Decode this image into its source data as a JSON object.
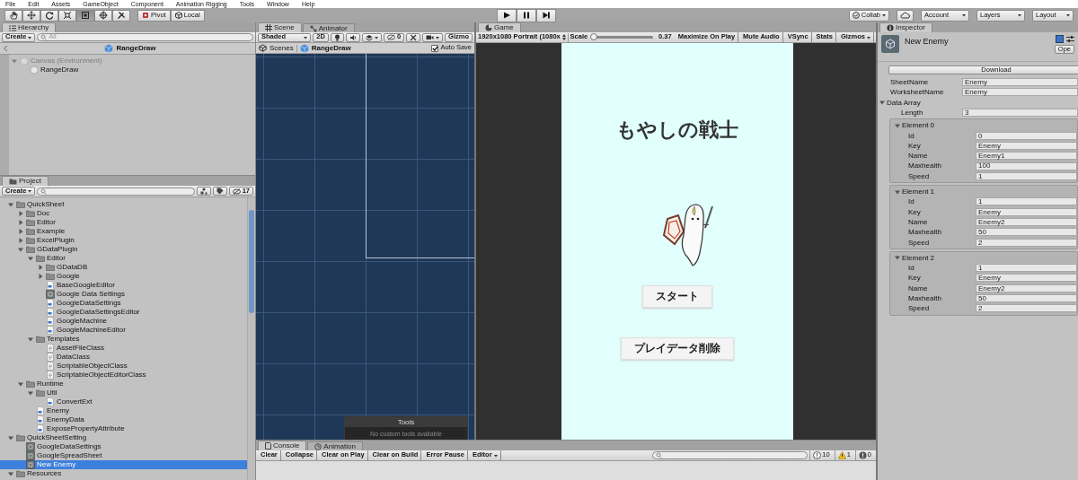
{
  "menu": [
    "File",
    "Edit",
    "Assets",
    "GameObject",
    "Component",
    "Animation Rigging",
    "Tools",
    "Window",
    "Help"
  ],
  "toolbar": {
    "tools": [
      {
        "kind": "hand",
        "selected": false
      },
      {
        "kind": "move",
        "selected": false
      },
      {
        "kind": "rotate",
        "selected": false
      },
      {
        "kind": "scale",
        "selected": false
      },
      {
        "kind": "rect",
        "selected": true
      },
      {
        "kind": "transform",
        "selected": false
      },
      {
        "kind": "custom",
        "selected": false
      }
    ],
    "pivot": "Pivot",
    "local": "Local",
    "playback": [
      {
        "kind": "play"
      },
      {
        "kind": "pause"
      },
      {
        "kind": "step"
      }
    ],
    "collab": "Collab",
    "account": "Account",
    "layers": "Layers",
    "layout": "Layout"
  },
  "hierarchy": {
    "tab": "Hierarchy",
    "create": "Create",
    "search_placeholder": "All",
    "scene": "RangeDraw",
    "items": [
      {
        "label": "Canvas (Environment)",
        "kind": "gameobject",
        "dimmed": true,
        "selected": false,
        "expanded": true,
        "children": [
          {
            "label": "RangeDraw",
            "kind": "gameobject",
            "dimmed": false,
            "selected": false
          }
        ]
      }
    ]
  },
  "project": {
    "tab": "Project",
    "create": "Create",
    "hidden_count": "17",
    "tree": [
      {
        "label": "QuickSheet",
        "kind": "folder",
        "expanded": true,
        "selected": false,
        "children": [
          {
            "label": "Doc",
            "kind": "folder",
            "expanded": false,
            "selected": false
          },
          {
            "label": "Editor",
            "kind": "folder",
            "expanded": false,
            "selected": false
          },
          {
            "label": "Example",
            "kind": "folder",
            "expanded": false,
            "selected": false
          },
          {
            "label": "ExcelPlugin",
            "kind": "folder",
            "expanded": false,
            "selected": false
          },
          {
            "label": "GDataPlugin",
            "kind": "folder",
            "expanded": true,
            "selected": false,
            "children": [
              {
                "label": "Editor",
                "kind": "folder",
                "expanded": true,
                "selected": false,
                "children": [
                  {
                    "label": "GDataDB",
                    "kind": "folder",
                    "expanded": false,
                    "selected": false
                  },
                  {
                    "label": "Google",
                    "kind": "folder",
                    "expanded": false,
                    "selected": false
                  },
                  {
                    "label": "BaseGoogleEditor",
                    "kind": "script",
                    "selected": false
                  },
                  {
                    "label": "Google Data Settings",
                    "kind": "asset",
                    "selected": false
                  },
                  {
                    "label": "GoogleDataSettings",
                    "kind": "script",
                    "selected": false
                  },
                  {
                    "label": "GoogleDataSettingsEditor",
                    "kind": "script",
                    "selected": false
                  },
                  {
                    "label": "GoogleMachine",
                    "kind": "script",
                    "selected": false
                  },
                  {
                    "label": "GoogleMachineEditor",
                    "kind": "script",
                    "selected": false
                  }
                ]
              },
              {
                "label": "Templates",
                "kind": "folder",
                "expanded": true,
                "selected": false,
                "children": [
                  {
                    "label": "AssetFileClass",
                    "kind": "text",
                    "selected": false
                  },
                  {
                    "label": "DataClass",
                    "kind": "text",
                    "selected": false
                  },
                  {
                    "label": "ScriptableObjectClass",
                    "kind": "text",
                    "selected": false
                  },
                  {
                    "label": "ScriptableObjectEditorClass",
                    "kind": "text",
                    "selected": false
                  }
                ]
              }
            ]
          },
          {
            "label": "Runtime",
            "kind": "folder",
            "expanded": true,
            "selected": false,
            "children": [
              {
                "label": "Util",
                "kind": "folder",
                "expanded": true,
                "selected": false,
                "children": [
                  {
                    "label": "ConvertExt",
                    "kind": "script",
                    "selected": false
                  }
                ]
              },
              {
                "label": "Enemy",
                "kind": "script",
                "selected": false
              },
              {
                "label": "EnemyData",
                "kind": "script",
                "selected": false
              },
              {
                "label": "ExposePropertyAttribute",
                "kind": "script",
                "selected": false
              }
            ]
          }
        ]
      },
      {
        "label": "QuickSheetSetting",
        "kind": "folder",
        "expanded": true,
        "selected": false,
        "children": [
          {
            "label": "GoogleDataSettings",
            "kind": "asset",
            "selected": false
          },
          {
            "label": "GoogleSpreadSheet",
            "kind": "asset",
            "selected": false
          },
          {
            "label": "New Enemy",
            "kind": "asset",
            "selected": true
          }
        ]
      },
      {
        "label": "Resources",
        "kind": "folder",
        "expanded": true,
        "selected": false
      }
    ]
  },
  "scene": {
    "tabs": [
      {
        "label": "Scene",
        "selected": true
      },
      {
        "label": "Animator",
        "selected": false
      }
    ],
    "shading": "Shaded",
    "mode_2d": "2D",
    "hidden_count": "0",
    "gizmos": "Gizmo",
    "breadcrumb": {
      "root": "Scenes",
      "scene": "RangeDraw"
    },
    "auto_save": {
      "label": "Auto Save",
      "checked": true
    },
    "tools_overlay": {
      "title": "Tools",
      "message": "No custom tools available"
    }
  },
  "game": {
    "tab": "Game",
    "resolution": "1920x1080 Portrait (1080x",
    "scale_label": "Scale",
    "scale": {
      "level": 0.02
    },
    "scale_value": "0.37",
    "toggles": [
      "Maximize On Play",
      "Mute Audio",
      "VSync",
      "Stats"
    ],
    "gizmos": "Gizmos",
    "screen": {
      "title": "もやしの戦士",
      "buttons": [
        "スタート",
        "プレイデータ削除"
      ]
    }
  },
  "inspector": {
    "tab": "Inspector",
    "object_name": "New Enemy",
    "open_button": "Ope",
    "download_button": "Download",
    "fields": [
      {
        "label": "SheetName",
        "value": "Enemy"
      },
      {
        "label": "WorksheetName",
        "value": "Enemy"
      }
    ],
    "data_array": {
      "label": "Data Array",
      "expanded": true,
      "length_label": "Length",
      "length": "3",
      "elements": [
        {
          "label": "Element 0",
          "expanded": true,
          "fields": [
            {
              "label": "Id",
              "value": "0"
            },
            {
              "label": "Key",
              "value": "Enemy"
            },
            {
              "label": "Name",
              "value": "Enemy1"
            },
            {
              "label": "Maxhealth",
              "value": "100"
            },
            {
              "label": "Speed",
              "value": "1"
            }
          ]
        },
        {
          "label": "Element 1",
          "expanded": true,
          "fields": [
            {
              "label": "Id",
              "value": "1"
            },
            {
              "label": "Key",
              "value": "Enemy"
            },
            {
              "label": "Name",
              "value": "Enemy2"
            },
            {
              "label": "Maxhealth",
              "value": "50"
            },
            {
              "label": "Speed",
              "value": "2"
            }
          ]
        },
        {
          "label": "Element 2",
          "expanded": true,
          "fields": [
            {
              "label": "Id",
              "value": "1"
            },
            {
              "label": "Key",
              "value": "Enemy"
            },
            {
              "label": "Name",
              "value": "Enemy2"
            },
            {
              "label": "Maxhealth",
              "value": "50"
            },
            {
              "label": "Speed",
              "value": "2"
            }
          ]
        }
      ]
    }
  },
  "console": {
    "tabs": [
      {
        "label": "Console",
        "selected": true
      },
      {
        "label": "Animation",
        "selected": false
      }
    ],
    "buttons": [
      "Clear",
      "Collapse",
      "Clear on Play",
      "Clear on Build",
      "Error Pause"
    ],
    "editor_dropdown": "Editor",
    "counts": [
      {
        "kind": "info",
        "count": "10"
      },
      {
        "kind": "warning",
        "count": "1"
      },
      {
        "kind": "error",
        "count": "0"
      }
    ]
  }
}
